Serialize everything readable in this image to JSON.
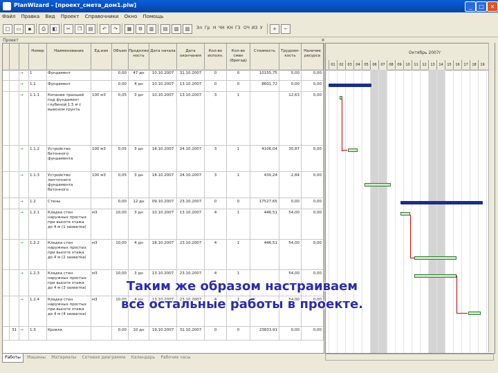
{
  "window": {
    "title": "PlanWizard - [проект_смета_дом1.plw]"
  },
  "menu": [
    "Файл",
    "Правка",
    "Вид",
    "Проект",
    "Справочники",
    "Окно",
    "Помощь"
  ],
  "toolbar": {
    "extra_labels": [
      "Эл",
      "Гр",
      "Н",
      "ЧН",
      "КН",
      "ГЗ",
      "ОЧ",
      "ИЗ",
      "У"
    ]
  },
  "project_label": "Проект",
  "columns": [
    "Номер",
    "Наименование",
    "Ед.изм",
    "Объем",
    "Продолжитель-ность",
    "Дата начала",
    "Дата окончания",
    "Кол-во исполн.",
    "Кол-во смен (бригад)",
    "Стоимость",
    "Трудоем-кость",
    "Наличие ресурса"
  ],
  "rows": [
    {
      "idx": "",
      "num": "1",
      "name": "Фундамент",
      "unit": "",
      "vol": "0,00",
      "dur": "47 дн",
      "start": "10.10.2007",
      "end": "31.10.2007",
      "ex": "0",
      "sh": "0",
      "cost": "10155,75",
      "lab": "0,00",
      "res": "0,00"
    },
    {
      "idx": "",
      "num": "1.1",
      "name": "Фундамент",
      "unit": "",
      "vol": "0,00",
      "dur": "4 дн",
      "start": "10.10.2007",
      "end": "13.10.2007",
      "ex": "0",
      "sh": "0",
      "cost": "8601,72",
      "lab": "0,00",
      "res": "0,00"
    },
    {
      "idx": "",
      "num": "1.1.1",
      "name": "Копание траншей под фундамент глубиной 1,5 м с вывозом грунта",
      "unit": "100 м3",
      "vol": "0,05",
      "dur": "3 дн",
      "start": "10.10.2007",
      "end": "13.10.2007",
      "ex": "3",
      "sh": "1",
      "cost": "",
      "lab": "12,63",
      "res": "0,00"
    },
    {
      "idx": "",
      "num": "1.1.2",
      "name": "Устройство бетонного фундамента",
      "unit": "100 м3",
      "vol": "0,05",
      "dur": "3 дн",
      "start": "18.10.2007",
      "end": "24.10.2007",
      "ex": "3",
      "sh": "1",
      "cost": "4106,04",
      "lab": "30,87",
      "res": "0,00"
    },
    {
      "idx": "",
      "num": "1.1.3",
      "name": "Устройство ленточного фундамента бетонного",
      "unit": "100 м3",
      "vol": "0,05",
      "dur": "3 дн",
      "start": "18.10.2007",
      "end": "24.10.2007",
      "ex": "3",
      "sh": "1",
      "cost": "430,24",
      "lab": "2,84",
      "res": "0,00"
    },
    {
      "idx": "",
      "num": "1.2",
      "name": "Стены",
      "unit": "",
      "vol": "0,00",
      "dur": "12 дн",
      "start": "09.10.2007",
      "end": "23.10.2007",
      "ex": "0",
      "sh": "0",
      "cost": "17527,65",
      "lab": "0,00",
      "res": "0,00"
    },
    {
      "idx": "",
      "num": "1.2.1",
      "name": "Кладка стен наружных простых при высоте этажа до 4 м (1 захватка)",
      "unit": "м3",
      "vol": "10,00",
      "dur": "3 дн",
      "start": "10.10.2007",
      "end": "13.10.2007",
      "ex": "4",
      "sh": "1",
      "cost": "446,51",
      "lab": "54,00",
      "res": "0,00"
    },
    {
      "idx": "",
      "num": "1.2.2",
      "name": "Кладка стен наружных простых при высоте этажа до 4 м (2 захватка)",
      "unit": "м3",
      "vol": "10,00",
      "dur": "4 дн",
      "start": "18.10.2007",
      "end": "23.10.2007",
      "ex": "4",
      "sh": "1",
      "cost": "446,51",
      "lab": "54,00",
      "res": "0,00"
    },
    {
      "idx": "",
      "num": "1.2.3",
      "name": "Кладка стен наружных простых при высоте этажа до 4 м (3 захватка)",
      "unit": "м3",
      "vol": "10,00",
      "dur": "3 дн",
      "start": "13.10.2007",
      "end": "23.10.2007",
      "ex": "4",
      "sh": "1",
      "cost": "",
      "lab": "54,00",
      "res": "0,00"
    },
    {
      "idx": "",
      "num": "1.2.4",
      "name": "Кладка стен наружных простых при высоте этажа до 4 м (4 захватка)",
      "unit": "м3",
      "vol": "10,00",
      "dur": "4 дн",
      "start": "13.10.2007",
      "end": "23.10.2007",
      "ex": "4",
      "sh": "1",
      "cost": "",
      "lab": "54,00",
      "res": "0,00"
    },
    {
      "idx": "31",
      "num": "1.3",
      "name": "Кровля",
      "unit": "",
      "vol": "0,00",
      "dur": "10 дн",
      "start": "19.10.2007",
      "end": "31.10.2007",
      "ex": "0",
      "sh": "0",
      "cost": "23833,91",
      "lab": "0,00",
      "res": "0,00"
    }
  ],
  "gantt": {
    "month_label": "Октябрь 2007г",
    "days": [
      "01",
      "02",
      "03",
      "04",
      "05",
      "06",
      "07",
      "08",
      "09",
      "10",
      "11",
      "12",
      "13",
      "14",
      "15",
      "16",
      "17",
      "18",
      "19"
    ]
  },
  "bottom_tabs": [
    "Работы",
    "Машины",
    "Материалы",
    "Сетевая диаграмма",
    "Календарь",
    "Рабочие часы"
  ],
  "caption": {
    "line1": "Таким же образом настраиваем",
    "line2": "все остальные работы в проекте."
  },
  "colors": {
    "title_bar": "#0842a8",
    "summary_bar": "#1f2c8a",
    "task_bar": "#cfe8c9",
    "link": "#c00000",
    "caption": "#2b2bb0"
  }
}
